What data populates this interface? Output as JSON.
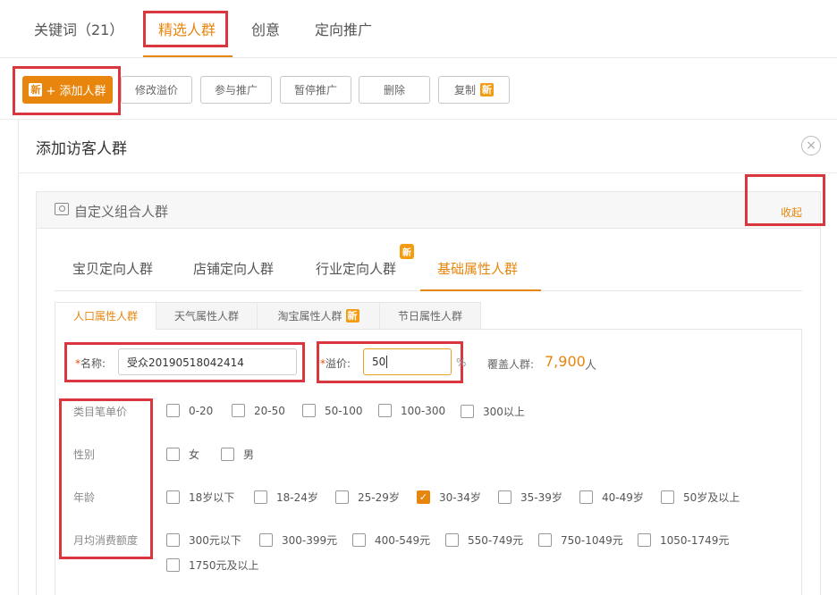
{
  "top_tabs": [
    {
      "label": "关键词（21）"
    },
    {
      "label": "精选人群"
    },
    {
      "label": "创意"
    },
    {
      "label": "定向推广"
    }
  ],
  "toolbar": {
    "new_badge": "新",
    "add_label": "+ 添加人群",
    "modify_bid": "修改溢价",
    "join_promo": "参与推广",
    "pause_promo": "暂停推广",
    "delete": "删除",
    "copy": "复制"
  },
  "panel": {
    "title": "添加访客人群",
    "close_symbol": "×"
  },
  "card": {
    "title": "自定义组合人群",
    "collapse_label": "收起"
  },
  "sub_tabs": [
    {
      "label": "宝贝定向人群"
    },
    {
      "label": "店铺定向人群"
    },
    {
      "label": "行业定向人群"
    },
    {
      "label": "基础属性人群"
    }
  ],
  "sub_new_flag": "新",
  "inner_tabs": [
    {
      "label": "人口属性人群"
    },
    {
      "label": "天气属性人群"
    },
    {
      "label": "淘宝属性人群"
    },
    {
      "label": "节日属性人群"
    }
  ],
  "form": {
    "req_mark": "*",
    "name_label": "名称:",
    "name_value": "受众20190518042414",
    "bid_label": "溢价:",
    "bid_value": "50",
    "percent": "%",
    "cover_label": "覆盖人群:",
    "cover_value": "7,900",
    "cover_unit": "人"
  },
  "rows": [
    {
      "label": "类目笔单价",
      "options": [
        {
          "label": "0-20",
          "checked": false
        },
        {
          "label": "20-50",
          "checked": false
        },
        {
          "label": "50-100",
          "checked": false
        },
        {
          "label": "100-300",
          "checked": false
        },
        {
          "label": "300以上",
          "checked": false
        }
      ]
    },
    {
      "label": "性别",
      "options": [
        {
          "label": "女",
          "checked": false
        },
        {
          "label": "男",
          "checked": false
        }
      ]
    },
    {
      "label": "年龄",
      "options": [
        {
          "label": "18岁以下",
          "checked": false
        },
        {
          "label": "18-24岁",
          "checked": false
        },
        {
          "label": "25-29岁",
          "checked": false
        },
        {
          "label": "30-34岁",
          "checked": true
        },
        {
          "label": "35-39岁",
          "checked": false
        },
        {
          "label": "40-49岁",
          "checked": false
        },
        {
          "label": "50岁及以上",
          "checked": false
        }
      ]
    },
    {
      "label": "月均消费额度",
      "options": [
        {
          "label": "300元以下",
          "checked": false
        },
        {
          "label": "300-399元",
          "checked": false
        },
        {
          "label": "400-549元",
          "checked": false
        },
        {
          "label": "550-749元",
          "checked": false
        },
        {
          "label": "750-1049元",
          "checked": false
        },
        {
          "label": "1050-1749元",
          "checked": false
        },
        {
          "label": "1750元及以上",
          "checked": false
        }
      ]
    }
  ],
  "colors": {
    "accent": "#e8850c",
    "highlight_frame": "#d9363e"
  }
}
